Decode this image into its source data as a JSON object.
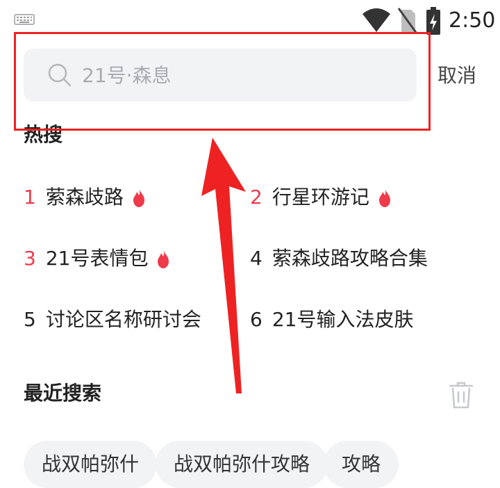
{
  "status_bar": {
    "time": "2:50",
    "icons": [
      "keyboard-icon",
      "wifi-icon",
      "no-sim-icon",
      "battery-charging-icon"
    ]
  },
  "search": {
    "placeholder": "21号·森息",
    "icon": "search-icon",
    "cancel_label": "取消"
  },
  "hot_search": {
    "title": "热搜",
    "items": [
      {
        "rank": "1",
        "text": "萦森歧路",
        "hot": true
      },
      {
        "rank": "2",
        "text": "行星环游记",
        "hot": true
      },
      {
        "rank": "3",
        "text": "21号表情包",
        "hot": true
      },
      {
        "rank": "4",
        "text": "萦森歧路攻略合集",
        "hot": false
      },
      {
        "rank": "5",
        "text": "讨论区名称研讨会",
        "hot": false
      },
      {
        "rank": "6",
        "text": "21号输入法皮肤",
        "hot": false
      }
    ]
  },
  "recent_search": {
    "title": "最近搜索",
    "clear_icon": "trash-icon",
    "chips": [
      "战双帕弥什",
      "战双帕弥什攻略",
      "攻略"
    ]
  },
  "colors": {
    "accent_red": "#ee3a4a",
    "annotation_red": "#ee2222",
    "search_bg": "#f2f3f5"
  }
}
